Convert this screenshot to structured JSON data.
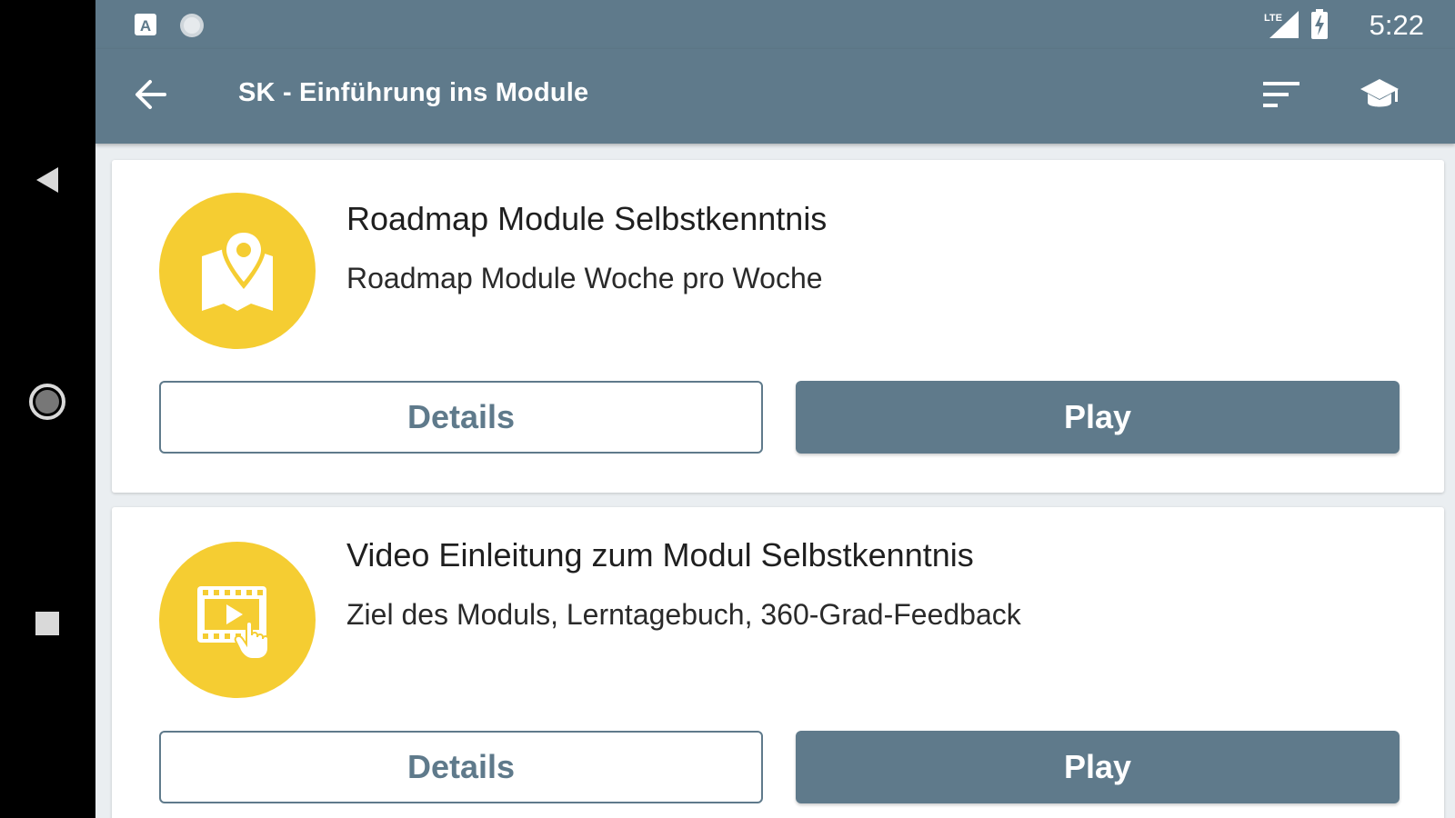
{
  "status_bar": {
    "time": "5:22",
    "network_label": "LTE"
  },
  "app_bar": {
    "title": "SK - Einführung ins Module"
  },
  "cards": [
    {
      "title": "Roadmap Module Selbstkenntnis",
      "subtitle": "Roadmap Module Woche pro Woche",
      "icon": "map-pin-icon",
      "details_label": "Details",
      "play_label": "Play"
    },
    {
      "title": "Video Einleitung zum Modul Selbstkenntnis",
      "subtitle": "Ziel des Moduls, Lerntagebuch, 360-Grad-Feedback",
      "icon": "video-touch-icon",
      "details_label": "Details",
      "play_label": "Play"
    }
  ],
  "colors": {
    "primary": "#5f7a8b",
    "accent": "#f5cd32",
    "background": "#eaeef1"
  }
}
